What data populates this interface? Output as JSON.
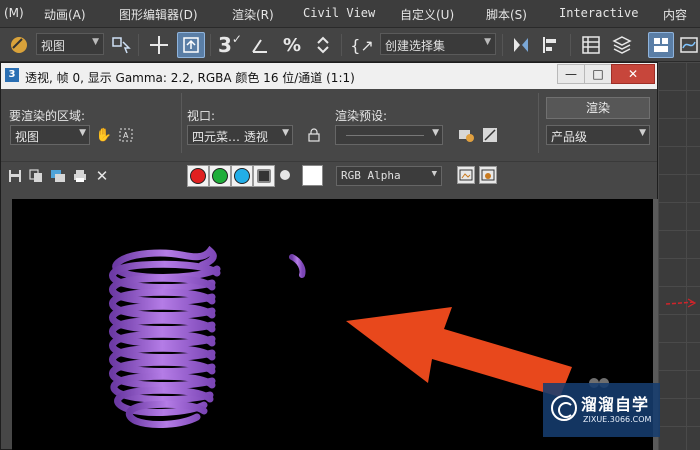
{
  "menubar": {
    "items": [
      {
        "label": "(M)"
      },
      {
        "label": "动画(A)"
      },
      {
        "label": "图形编辑器(D)"
      },
      {
        "label": "渲染(R)"
      },
      {
        "label": "Civil View"
      },
      {
        "label": "自定义(U)"
      },
      {
        "label": "脚本(S)"
      },
      {
        "label": "Interactive"
      },
      {
        "label": "内容"
      }
    ]
  },
  "toolbar": {
    "view_dropdown": "视图",
    "selection_set_dropdown": "创建选择集",
    "snap_label": "3"
  },
  "render_frame": {
    "window_title": "透视, 帧 0, 显示 Gamma: 2.2, RGBA 颜色 16 位/通道 (1:1)",
    "app_icon_label": "3",
    "minimize_label": "—",
    "maximize_label": "□",
    "close_label": "✕",
    "area_label": "要渲染的区域:",
    "area_value": "视图",
    "viewport_label": "视口:",
    "viewport_value": "四元菜… 透视",
    "preset_label": "渲染预设:",
    "preset_value": "",
    "render_button": "渲染",
    "render_quality": "产品级",
    "channel_value": "RGB Alpha"
  },
  "watermark": {
    "title": "溜溜自学",
    "subtitle": "ZIXUE.3066.COM"
  },
  "colors": {
    "accent": "#5a7ea6",
    "spring": "#9b5fd0",
    "arrow": "#e8481c",
    "close": "#c7463b"
  }
}
